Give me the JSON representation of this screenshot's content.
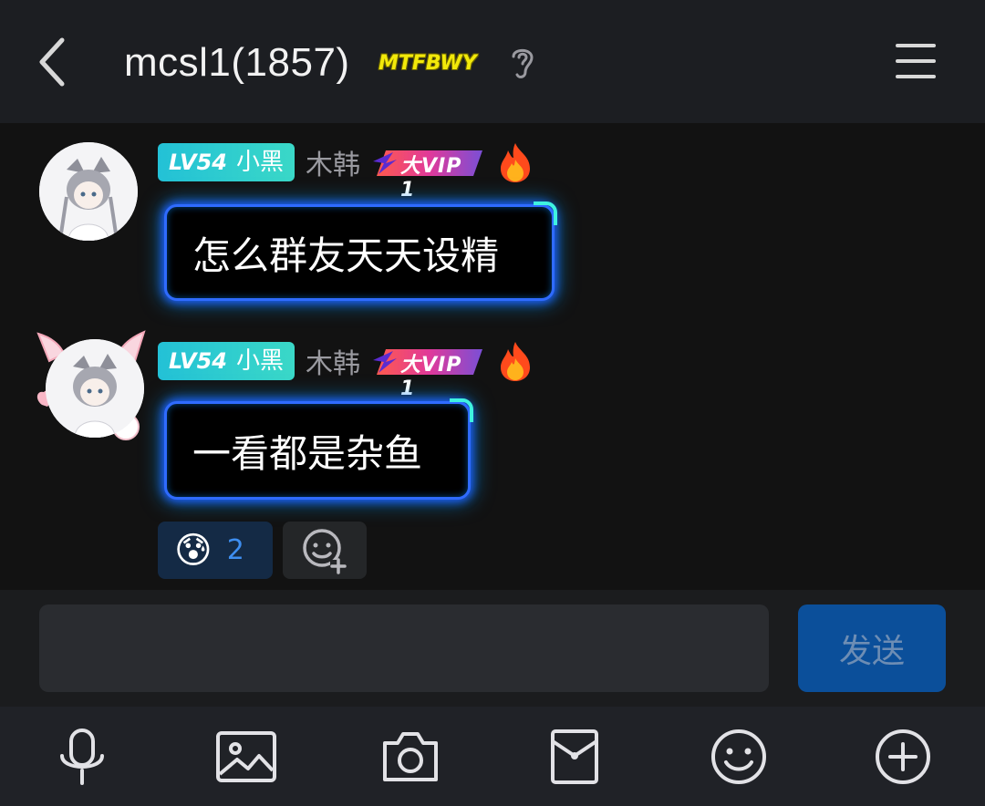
{
  "header": {
    "title": "mcsl1(1857)",
    "badge": "MTFBWY",
    "icons": {
      "back": "chevron-left-icon",
      "ear": "ear-icon",
      "menu": "hamburger-menu-icon"
    }
  },
  "messages": [
    {
      "level": "LV54",
      "title": "小黑",
      "sender": "木韩",
      "vip": "大VIP 1",
      "text": "怎么群友天天设精"
    },
    {
      "level": "LV54",
      "title": "小黑",
      "sender": "木韩",
      "vip": "大VIP 1",
      "text": "一看都是杂鱼",
      "reactions": [
        {
          "emoji": "😰",
          "count": "2"
        }
      ]
    }
  ],
  "composer": {
    "value": "",
    "send_label": "发送"
  },
  "toolbar": {
    "items": [
      "microphone-icon",
      "image-icon",
      "camera-icon",
      "red-packet-icon",
      "smiley-icon",
      "plus-icon"
    ]
  },
  "colors": {
    "background": "#121212",
    "header": "#1c1e22",
    "accent": "#0b4f9a",
    "level_badge": "#2ccbd0",
    "bubble_glow": "#2f6bff"
  }
}
